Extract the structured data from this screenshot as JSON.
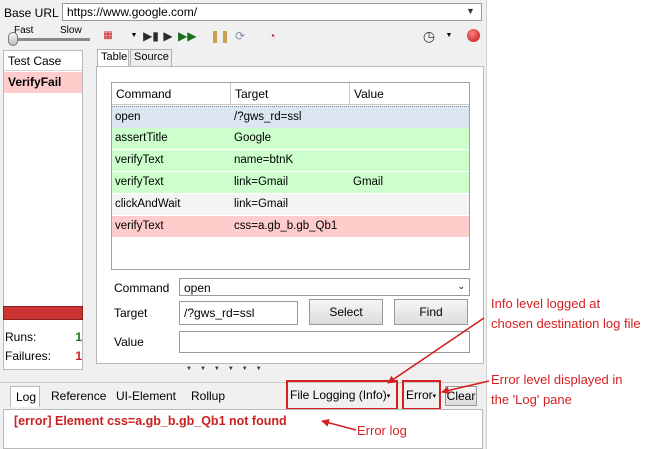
{
  "base_url": {
    "label": "Base URL",
    "value": "https://www.google.com/"
  },
  "speed": {
    "fast": "Fast",
    "slow": "Slow"
  },
  "test_case_panel": {
    "header": "Test Case",
    "items": [
      "VerifyFail"
    ]
  },
  "stats": {
    "runs_label": "Runs:",
    "runs_value": "1",
    "failures_label": "Failures:",
    "failures_value": "1"
  },
  "tabs": [
    "Table",
    "Source"
  ],
  "table": {
    "headers": [
      "Command",
      "Target",
      "Value"
    ],
    "rows": [
      {
        "command": "open",
        "target": "/?gws_rd=ssl",
        "value": "",
        "status": "selected"
      },
      {
        "command": "assertTitle",
        "target": "Google",
        "value": "",
        "status": "passed"
      },
      {
        "command": "verifyText",
        "target": "name=btnK",
        "value": "",
        "status": "passed"
      },
      {
        "command": "verifyText",
        "target": "link=Gmail",
        "value": "Gmail",
        "status": "passed"
      },
      {
        "command": "clickAndWait",
        "target": "link=Gmail",
        "value": "",
        "status": "neutral"
      },
      {
        "command": "verifyText",
        "target": "css=a.gb_b.gb_Qb1",
        "value": "",
        "status": "failed"
      }
    ]
  },
  "form": {
    "command_label": "Command",
    "command_value": "open",
    "target_label": "Target",
    "target_value": "/?gws_rd=ssl",
    "value_label": "Value",
    "value_value": "",
    "select_button": "Select",
    "find_button": "Find"
  },
  "bottom_tabs": [
    "Log",
    "Reference",
    "UI-Element",
    "Rollup"
  ],
  "log_controls": {
    "file_logging": "File Logging (Info)",
    "level": "Error",
    "clear": "Clear"
  },
  "log_lines": [
    "[error] Element css=a.gb_b.gb_Qb1 not found"
  ],
  "annotations": {
    "info_level": "Info level logged at chosen destination log file",
    "error_level": "Error level displayed in the 'Log' pane",
    "error_log": "Error log"
  },
  "colors": {
    "selected": "#dce6f0",
    "passed": "#ccffcc",
    "neutral": "#f4f4f4",
    "failed": "#ffcccc",
    "annotation": "#d42020"
  }
}
